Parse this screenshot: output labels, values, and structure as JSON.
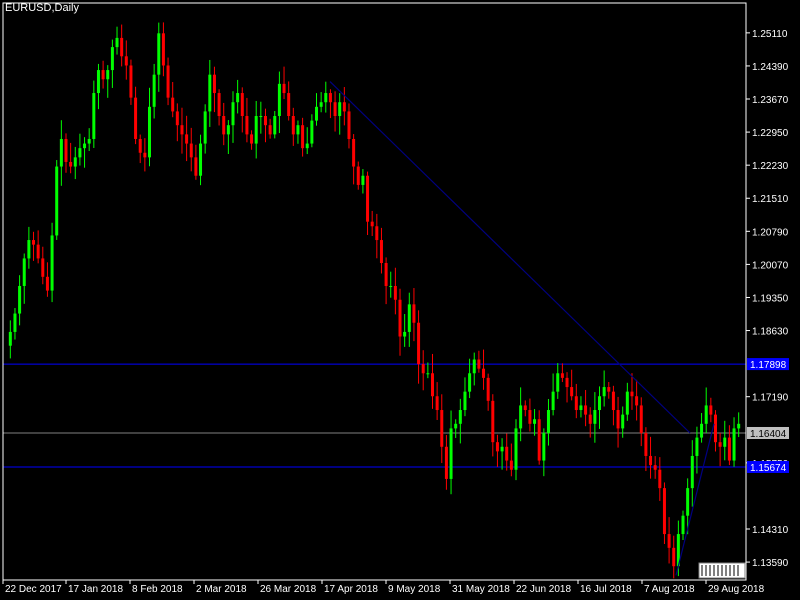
{
  "window": {
    "title": "EURUSD,Daily"
  },
  "colors": {
    "background": "#000000",
    "frame": "#ffffff",
    "bull": "#00ff00",
    "bear": "#ff0000",
    "horizontal_level": "#0000ff",
    "trendline": "#000080",
    "current_price_line": "#808080",
    "current_price_tag": "#c0c0c0"
  },
  "chart_data": {
    "type": "candlestick",
    "symbol": "EURUSD",
    "timeframe": "Daily",
    "title": "EURUSD,Daily",
    "ylim": [
      1.132,
      1.2576
    ],
    "y_ticks": [
      "1.25110",
      "1.24390",
      "1.23670",
      "1.22950",
      "1.22230",
      "1.21510",
      "1.20790",
      "1.20070",
      "1.19350",
      "1.18630",
      "1.17190",
      "1.15750",
      "1.14310",
      "1.13590"
    ],
    "x_ticks": [
      "22 Dec 2017",
      "17 Jan 2018",
      "8 Feb 2018",
      "2 Mar 2018",
      "26 Mar 2018",
      "17 Apr 2018",
      "9 May 2018",
      "31 May 2018",
      "22 Jun 2018",
      "16 Jul 2018",
      "7 Aug 2018",
      "29 Aug 2018"
    ],
    "horizontal_levels": [
      {
        "price": 1.179,
        "label": "1.17898"
      },
      {
        "price": 1.1566,
        "label": "1.15674"
      }
    ],
    "current_price": {
      "price": 1.164,
      "label": "1.16404"
    },
    "trendline_1": {
      "from": [
        "16 Apr 2018",
        1.2405
      ],
      "to": [
        "14 Aug 2018",
        1.164
      ]
    },
    "trendline_2": {
      "from": [
        "16 Aug 2018",
        1.133
      ],
      "to": [
        "29 Aug 2018",
        1.166
      ]
    },
    "closes": [
      1.186,
      1.19,
      1.196,
      1.202,
      1.206,
      1.205,
      1.202,
      1.198,
      1.195,
      1.207,
      1.222,
      1.228,
      1.223,
      1.222,
      1.224,
      1.226,
      1.227,
      1.228,
      1.238,
      1.243,
      1.241,
      1.243,
      1.248,
      1.25,
      1.246,
      1.244,
      1.237,
      1.228,
      1.225,
      1.224,
      1.235,
      1.242,
      1.251,
      1.244,
      1.237,
      1.234,
      1.231,
      1.229,
      1.227,
      1.224,
      1.22,
      1.227,
      1.234,
      1.242,
      1.238,
      1.233,
      1.229,
      1.231,
      1.236,
      1.238,
      1.233,
      1.229,
      1.227,
      1.233,
      1.233,
      1.231,
      1.229,
      1.233,
      1.24,
      1.238,
      1.233,
      1.229,
      1.231,
      1.226,
      1.227,
      1.232,
      1.235,
      1.236,
      1.238,
      1.236,
      1.233,
      1.236,
      1.234,
      1.228,
      1.222,
      1.218,
      1.22,
      1.21,
      1.209,
      1.206,
      1.201,
      1.196,
      1.196,
      1.193,
      1.185,
      1.186,
      1.192,
      1.188,
      1.179,
      1.177,
      1.177,
      1.172,
      1.169,
      1.161,
      1.154,
      1.165,
      1.166,
      1.169,
      1.173,
      1.177,
      1.18,
      1.178,
      1.176,
      1.171,
      1.162,
      1.16,
      1.161,
      1.158,
      1.156,
      1.165,
      1.17,
      1.169,
      1.166,
      1.167,
      1.158,
      1.164,
      1.169,
      1.173,
      1.177,
      1.176,
      1.174,
      1.172,
      1.169,
      1.17,
      1.168,
      1.166,
      1.169,
      1.172,
      1.174,
      1.173,
      1.169,
      1.165,
      1.168,
      1.173,
      1.172,
      1.17,
      1.164,
      1.159,
      1.157,
      1.156,
      1.152,
      1.142,
      1.139,
      1.135,
      1.142,
      1.146,
      1.152,
      1.159,
      1.163,
      1.166,
      1.17,
      1.168,
      1.162,
      1.161,
      1.163,
      1.158,
      1.165,
      1.166
    ]
  }
}
